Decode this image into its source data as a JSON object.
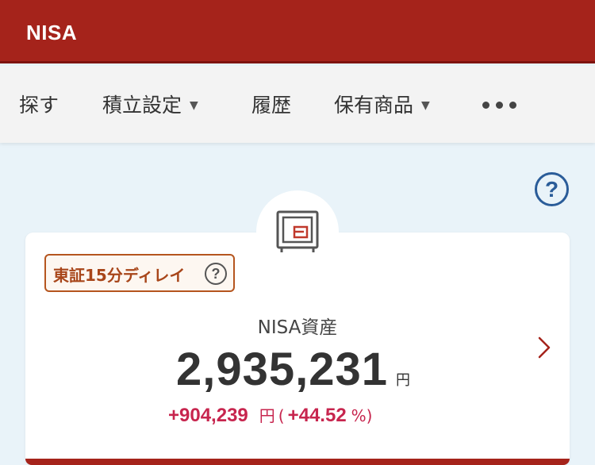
{
  "header": {
    "title": "NISA"
  },
  "nav": {
    "items": [
      {
        "label": "探す"
      },
      {
        "label": "積立設定",
        "caret": "▼"
      },
      {
        "label": "履歴"
      },
      {
        "label": "保有商品",
        "caret": "▼"
      }
    ],
    "more_icon": "more-horizontal-icon"
  },
  "help": {
    "label": "?"
  },
  "card": {
    "icon": "safe-icon",
    "delay_badge": {
      "label": "東証15分ディレイ",
      "help": "?"
    },
    "asset_label": "NISA資産",
    "asset_value": "2,935,231",
    "asset_unit": "円",
    "change_amount": "+904,239",
    "change_unit": "円",
    "change_paren_open": "(",
    "change_percent": "+44.52",
    "change_percent_sign": "%)"
  },
  "colors": {
    "brand_red": "#a5231b",
    "gain_pink": "#c7254e",
    "help_blue": "#2a5c99",
    "background": "#e9f3f9"
  }
}
